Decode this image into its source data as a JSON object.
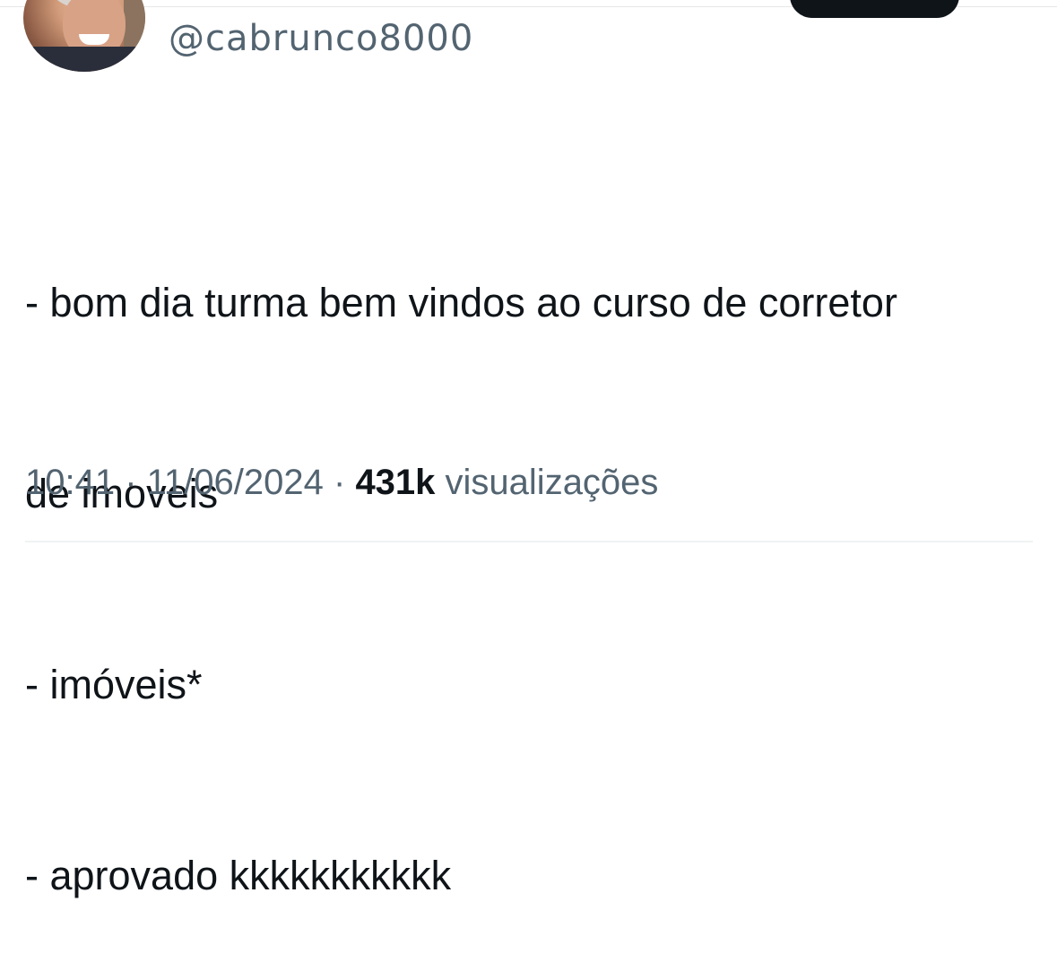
{
  "header": {
    "handle": "@cabrunco8000"
  },
  "tweet": {
    "lines": [
      "- bom dia turma bem vindos ao curso de corretor",
      "de imoveis",
      "- imóveis*",
      "- aprovado kkkkkkkkkkk"
    ]
  },
  "meta": {
    "time": "10:41",
    "separator_1": " · ",
    "date": "11/06/2024",
    "separator_2": " · ",
    "views_count": "431k",
    "views_label": " visualizações"
  },
  "colors": {
    "text_primary": "#0f1419",
    "text_secondary": "#536471",
    "button_bg": "#0f1419"
  }
}
